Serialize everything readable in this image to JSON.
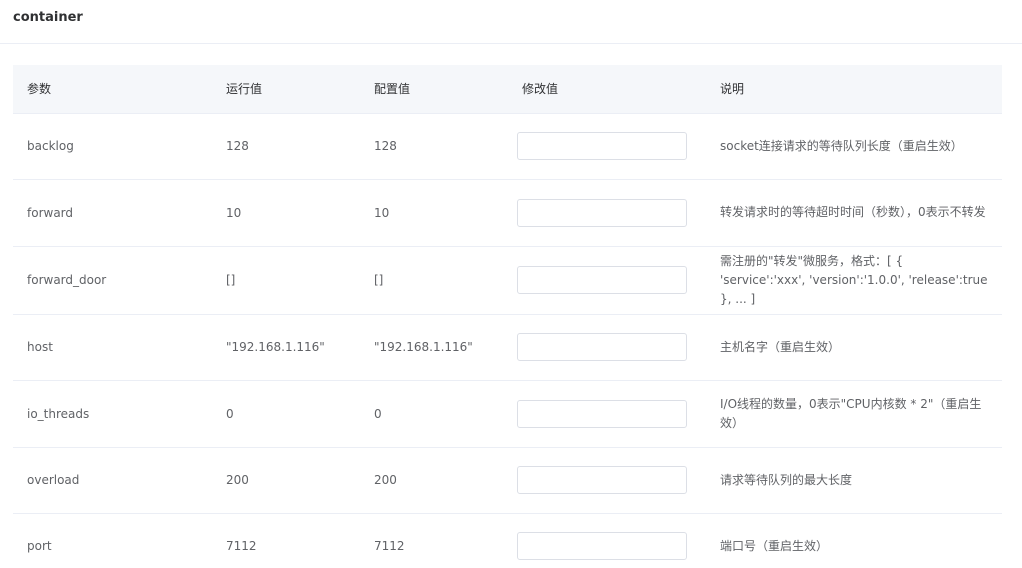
{
  "card": {
    "title": "container"
  },
  "table": {
    "headers": [
      "参数",
      "运行值",
      "配置值",
      "修改值",
      "说明"
    ],
    "rows": [
      {
        "param": "backlog",
        "run": "128",
        "config": "128",
        "input": "",
        "desc": "socket连接请求的等待队列长度（重启生效）"
      },
      {
        "param": "forward",
        "run": "10",
        "config": "10",
        "input": "",
        "desc": "转发请求时的等待超时时间（秒数），0表示不转发"
      },
      {
        "param": "forward_door",
        "run": "[]",
        "config": "[]",
        "input": "",
        "desc": "需注册的\"转发\"微服务，格式：[ { 'service':'xxx', 'version':'1.0.0', 'release':true }, ... ]"
      },
      {
        "param": "host",
        "run": "\"192.168.1.116\"",
        "config": "\"192.168.1.116\"",
        "input": "",
        "desc": "主机名字（重启生效）"
      },
      {
        "param": "io_threads",
        "run": "0",
        "config": "0",
        "input": "",
        "desc": "I/O线程的数量，0表示\"CPU内核数 * 2\"（重启生效）"
      },
      {
        "param": "overload",
        "run": "200",
        "config": "200",
        "input": "",
        "desc": "请求等待队列的最大长度"
      },
      {
        "param": "port",
        "run": "7112",
        "config": "7112",
        "input": "",
        "desc": "端口号（重启生效）"
      }
    ]
  }
}
